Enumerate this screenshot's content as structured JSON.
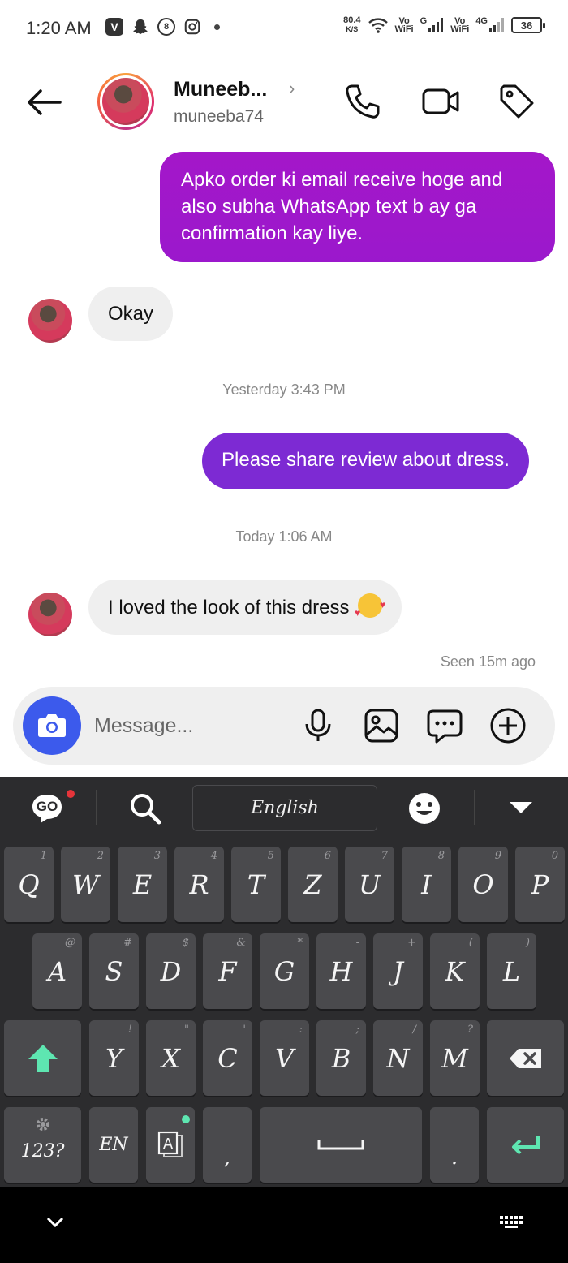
{
  "status_bar": {
    "time": "1:20 AM",
    "net_speed_value": "80.4",
    "net_speed_unit": "K/S",
    "vowifi_1_top": "Vo",
    "vowifi_1_bottom": "WiFi",
    "network_1": "G",
    "vowifi_2_top": "Vo",
    "vowifi_2_bottom": "WiFi",
    "network_2": "4G",
    "battery": "36"
  },
  "header": {
    "contact_name": "Muneeb...",
    "username": "muneeba74",
    "chevron": "›"
  },
  "messages": [
    {
      "type": "outgoing",
      "text": "Apko order ki email receive hoge and also subha WhatsApp text b ay ga confirmation kay liye."
    },
    {
      "type": "incoming",
      "text": "Okay"
    },
    {
      "type": "timestamp",
      "text": "Yesterday 3:43 PM"
    },
    {
      "type": "outgoing",
      "text": "Please share review about dress."
    },
    {
      "type": "timestamp",
      "text": "Today 1:06 AM"
    },
    {
      "type": "incoming",
      "text": "I loved the look of this dress"
    }
  ],
  "seen_text": "Seen 15m ago",
  "composer": {
    "placeholder": "Message..."
  },
  "keyboard": {
    "logo": "GO",
    "language": "English",
    "row1": [
      {
        "key": "Q",
        "hint": "1"
      },
      {
        "key": "W",
        "hint": "2"
      },
      {
        "key": "E",
        "hint": "3"
      },
      {
        "key": "R",
        "hint": "4"
      },
      {
        "key": "T",
        "hint": "5"
      },
      {
        "key": "Z",
        "hint": "6"
      },
      {
        "key": "U",
        "hint": "7"
      },
      {
        "key": "I",
        "hint": "8"
      },
      {
        "key": "O",
        "hint": "9"
      },
      {
        "key": "P",
        "hint": "0"
      }
    ],
    "row2": [
      {
        "key": "A",
        "hint": "@"
      },
      {
        "key": "S",
        "hint": "#"
      },
      {
        "key": "D",
        "hint": "$"
      },
      {
        "key": "F",
        "hint": "&"
      },
      {
        "key": "G",
        "hint": "*"
      },
      {
        "key": "H",
        "hint": "-"
      },
      {
        "key": "J",
        "hint": "+"
      },
      {
        "key": "K",
        "hint": "("
      },
      {
        "key": "L",
        "hint": ")"
      }
    ],
    "row3": [
      {
        "key": "Y",
        "hint": "!"
      },
      {
        "key": "X",
        "hint": "\""
      },
      {
        "key": "C",
        "hint": "'"
      },
      {
        "key": "V",
        "hint": ":"
      },
      {
        "key": "B",
        "hint": ";"
      },
      {
        "key": "N",
        "hint": "/"
      },
      {
        "key": "M",
        "hint": "?"
      }
    ],
    "numbers_key": "123?",
    "lang_key": "EN",
    "comma": ",",
    "period": "."
  }
}
